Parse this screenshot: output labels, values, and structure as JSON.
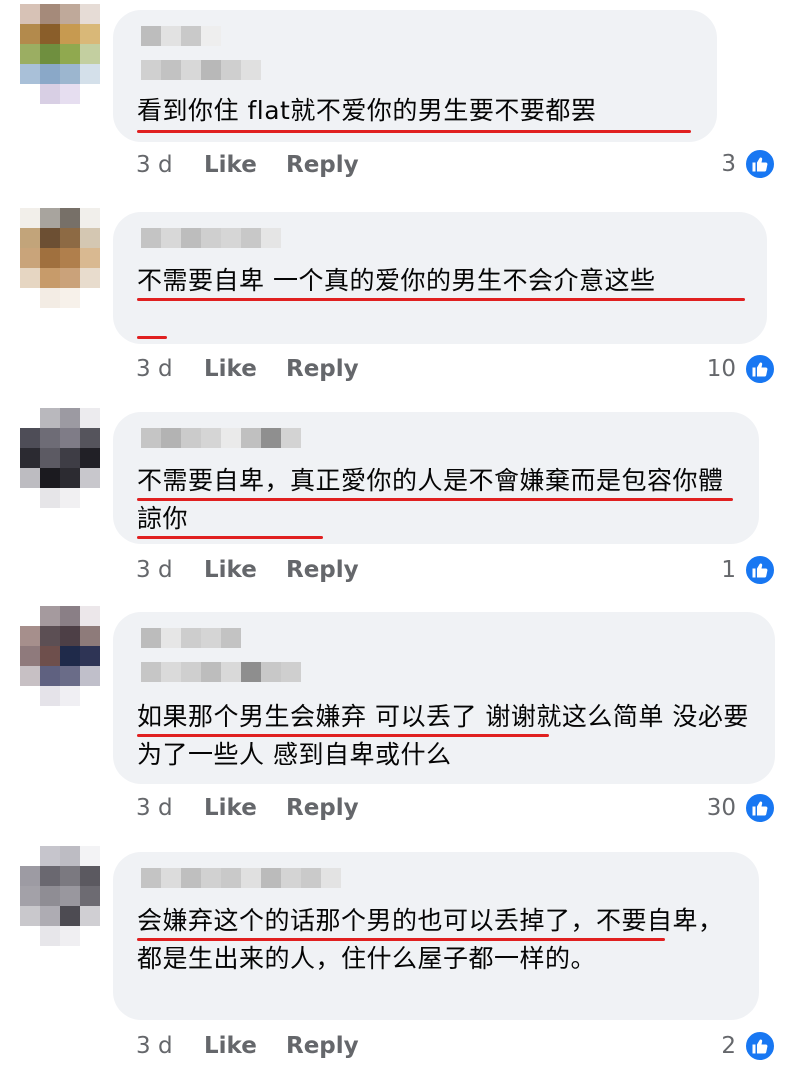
{
  "comments": [
    {
      "text": "看到你住 flat就不爱你的男生要不要都罢",
      "time": "3 d",
      "like_label": "Like",
      "reply_label": "Reply",
      "reactions": "3"
    },
    {
      "text": "不需要自卑 一个真的爱你的男生不会介意这些",
      "time": "3 d",
      "like_label": "Like",
      "reply_label": "Reply",
      "reactions": "10"
    },
    {
      "text": "不需要自卑，真正愛你的人是不會嫌棄而是包容你體諒你",
      "time": "3 d",
      "like_label": "Like",
      "reply_label": "Reply",
      "reactions": "1"
    },
    {
      "text": "如果那个男生会嫌弃 可以丢了 谢谢就这么简单 没必要为了一些人 感到自卑或什么",
      "time": "3 d",
      "like_label": "Like",
      "reply_label": "Reply",
      "reactions": "30"
    },
    {
      "text": "会嫌弃这个的话那个男的也可以丢掉了，不要自卑，都是生出来的人，住什么屋子都一样的。",
      "time": "3 d",
      "like_label": "Like",
      "reply_label": "Reply",
      "reactions": "2"
    }
  ],
  "colors": {
    "bubble": "#f0f2f5",
    "meta": "#65676b",
    "like_blue": "#1877f2",
    "underline": "#e02020"
  },
  "icons": {
    "reaction": "thumbs-up-icon"
  }
}
